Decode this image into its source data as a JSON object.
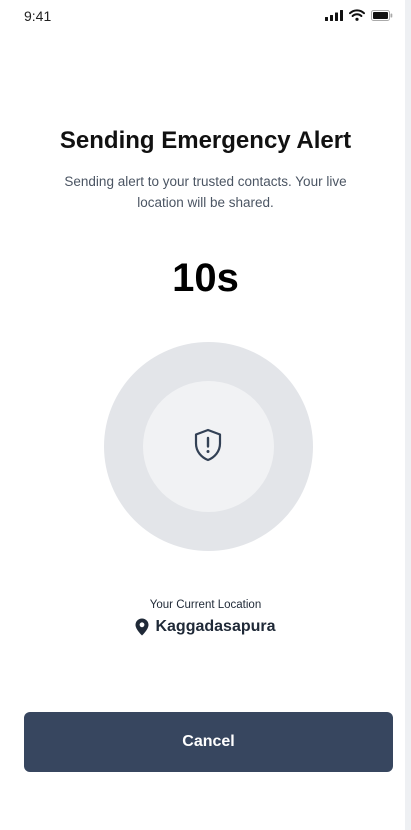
{
  "status_bar": {
    "time": "9:41",
    "icons": [
      "signal-icon",
      "wifi-icon",
      "battery-icon"
    ]
  },
  "header": {
    "title": "Sending Emergency Alert",
    "subtitle": "Sending alert to your trusted contacts. Your live location will be shared."
  },
  "countdown": {
    "value": "10s"
  },
  "center_icon": "shield-alert-icon",
  "location": {
    "label": "Your Current Location",
    "icon": "map-pin-icon",
    "name": "Kaggadasapura"
  },
  "actions": {
    "cancel_label": "Cancel"
  },
  "colors": {
    "primary_button": "#37465f",
    "outer_circle": "#e3e5e9",
    "inner_circle": "#f1f2f4",
    "icon_stroke": "#334155"
  }
}
